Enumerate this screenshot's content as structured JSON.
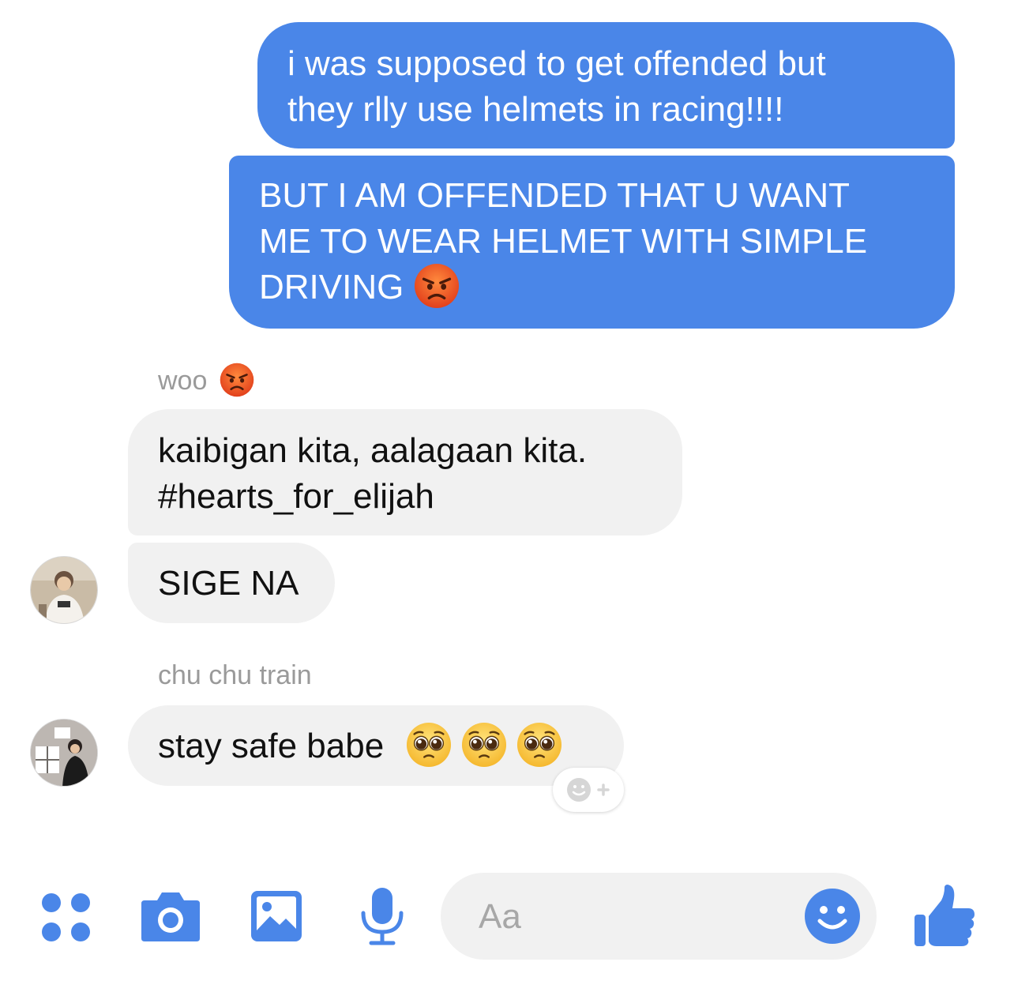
{
  "accent_color": "#4a86e8",
  "messages": [
    {
      "id": "msg1",
      "direction": "sent",
      "text": "i was supposed to get offended but\nthey rlly use helmets in racing!!!!"
    },
    {
      "id": "msg2",
      "direction": "sent",
      "text": "BUT I AM OFFENDED THAT U WANT\nME TO WEAR HELMET WITH SIMPLE\nDRIVING ",
      "emoji": "angry-face"
    },
    {
      "id": "msg3",
      "direction": "received",
      "sender": "woo",
      "sender_emoji": "angry-face",
      "text": "kaibigan kita, aalagaan kita.\n#hearts_for_elijah"
    },
    {
      "id": "msg4",
      "direction": "received",
      "text": "SIGE NA"
    },
    {
      "id": "msg5",
      "direction": "received",
      "sender": "chu chu train",
      "text": "stay safe babe ",
      "emoji": [
        "pleading-face",
        "pleading-face",
        "pleading-face"
      ]
    }
  ],
  "senders": {
    "woo": "woo",
    "chu": "chu chu train"
  },
  "composer": {
    "placeholder": "Aa",
    "tools": [
      "more-apps-icon",
      "camera-icon",
      "gallery-icon",
      "microphone-icon"
    ],
    "emoji_button": "smile-icon",
    "send_button": "thumbs-up-icon"
  }
}
